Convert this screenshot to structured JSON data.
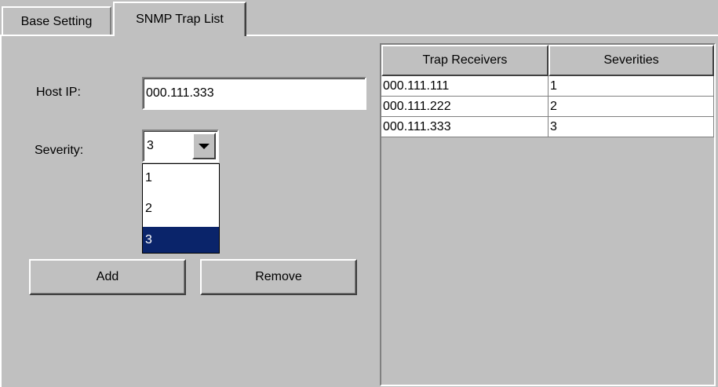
{
  "tabs": [
    {
      "label": "Base Setting",
      "active": false
    },
    {
      "label": "SNMP Trap List",
      "active": true
    }
  ],
  "form": {
    "host_ip_label": "Host IP:",
    "host_ip_value": "000.111.333",
    "severity_label": "Severity:",
    "severity_value": "3",
    "severity_options": [
      "1",
      "2",
      "3"
    ],
    "severity_highlighted": "3",
    "add_label": "Add",
    "remove_label": "Remove"
  },
  "table": {
    "columns": [
      "Trap Receivers",
      "Severities"
    ],
    "rows": [
      [
        "000.111.111",
        "1"
      ],
      [
        "000.111.222",
        "2"
      ],
      [
        "000.111.333",
        "3"
      ]
    ]
  },
  "icons": {
    "combo_arrow": "chevron-down-icon"
  },
  "colors": {
    "selection": "#0a246a",
    "background": "#c0c0c0"
  }
}
